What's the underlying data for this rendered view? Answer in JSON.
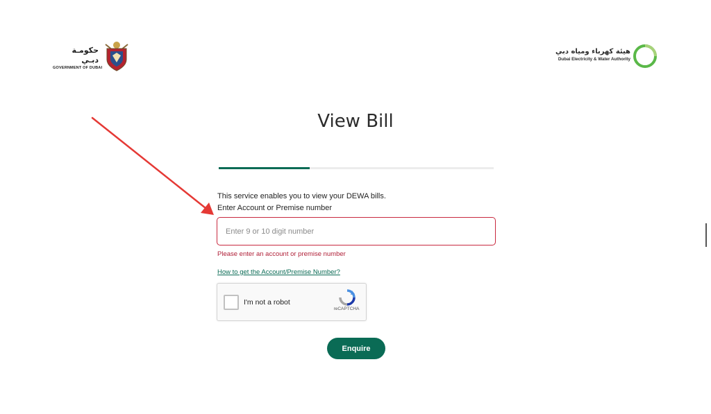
{
  "header": {
    "gov_logo": {
      "arabic": "حكومـة دبـي",
      "english": "GOVERNMENT OF DUBAI"
    },
    "dewa_logo": {
      "arabic": "هيئة كهرباء ومياه دبي",
      "english": "Dubai Electricity & Water Authority"
    }
  },
  "page": {
    "title": "View Bill",
    "progress_fraction": 0.33
  },
  "form": {
    "intro": "This service enables you to view your DEWA bills.",
    "field_label": "Enter Account or Premise number",
    "input": {
      "placeholder": "Enter 9 or 10 digit number",
      "value": ""
    },
    "error": "Please enter an account or premise number",
    "help_link": "How to get the Account/Premise Number?",
    "captcha": {
      "label": "I'm not a robot",
      "brand": "reCAPTCHA"
    },
    "submit_label": "Enquire"
  },
  "colors": {
    "accent": "#0a6b55",
    "error": "#c8283e",
    "annotation_arrow": "#e53935"
  }
}
